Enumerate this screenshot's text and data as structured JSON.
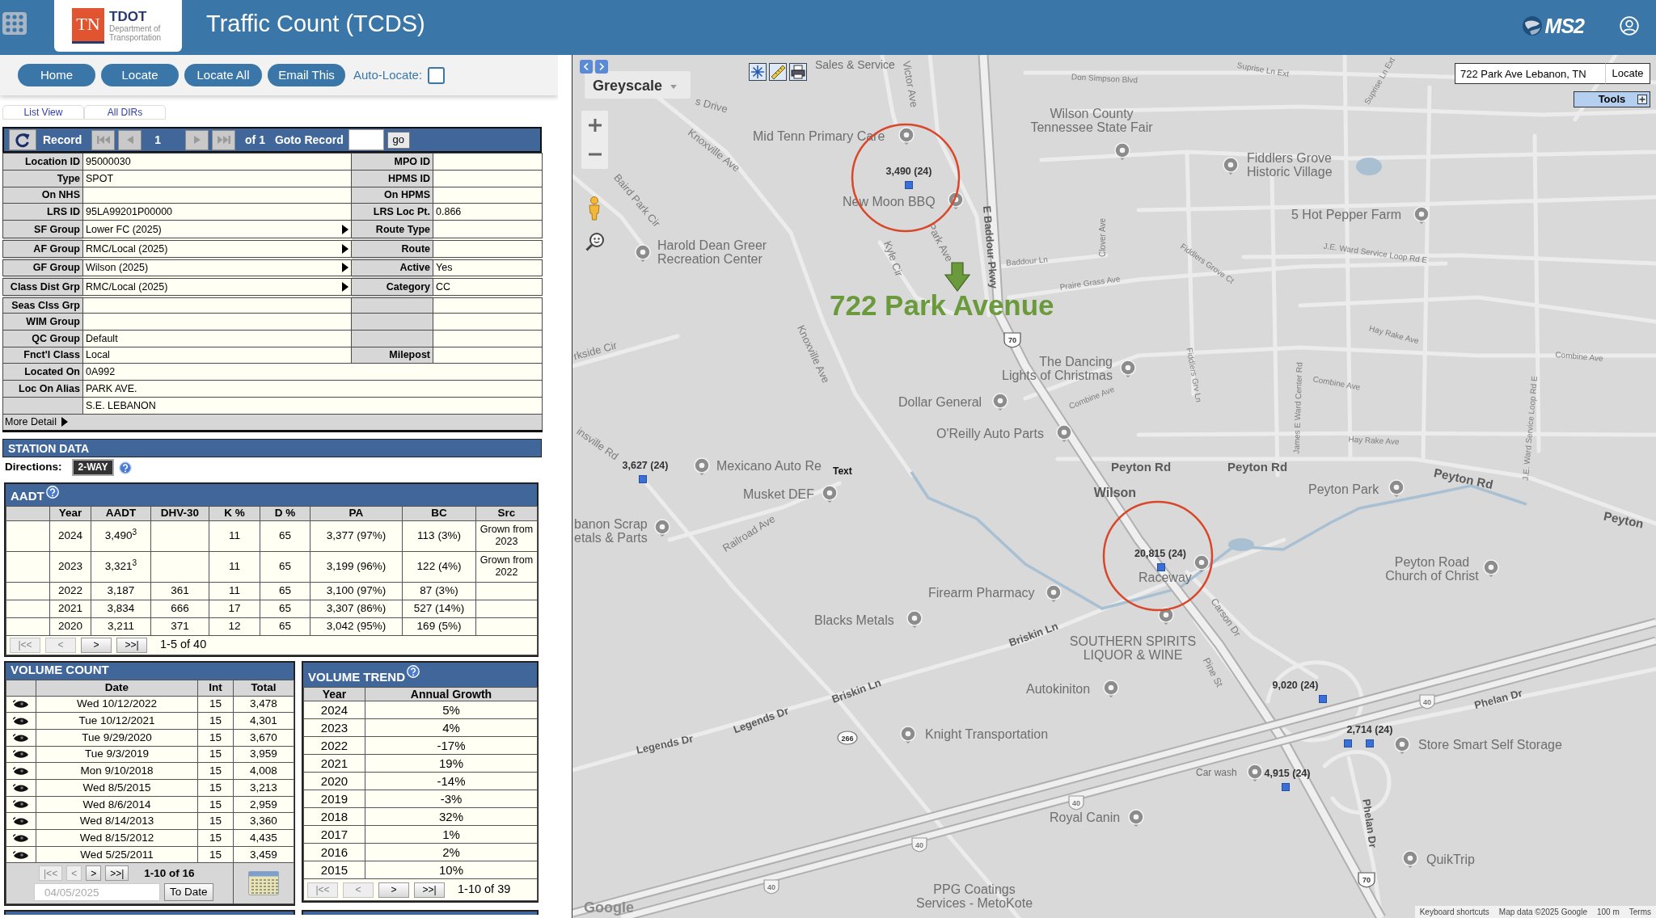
{
  "header": {
    "title": "Traffic Count (TCDS)",
    "logo": {
      "mark": "TN",
      "name": "TDOT",
      "subtitle": "Department of Transportation"
    },
    "brand": "MS2"
  },
  "toolbar": {
    "buttons": [
      "Home",
      "Locate",
      "Locate All",
      "Email This"
    ],
    "auto_locate": {
      "label": "Auto-Locate:",
      "checked": false
    }
  },
  "view_links": [
    "List View",
    "All DIRs"
  ],
  "record_bar": {
    "label": "Record",
    "current": "1",
    "total": "of 1",
    "goto_label": "Goto Record",
    "go_button": "go"
  },
  "location": {
    "rows": [
      {
        "kind": "pair",
        "label": "Location ID",
        "value": "95000030",
        "right_label": "MPO ID",
        "submenu": false
      },
      {
        "kind": "pair",
        "label": "Type",
        "value": "SPOT",
        "right_label": "HPMS ID",
        "submenu": false
      },
      {
        "kind": "pair",
        "label": "On NHS",
        "right_label": "On HPMS",
        "submenu": false
      },
      {
        "kind": "pair",
        "label": "LRS ID",
        "value": "95LA99201P00000",
        "right_label": "LRS Loc Pt.",
        "right_value": "0.866",
        "submenu": false
      },
      {
        "kind": "pair",
        "label": "SF Group",
        "value": "Lower FC (2025)",
        "right_label": "Route Type",
        "submenu": true
      },
      {
        "kind": "pair",
        "label": "AF Group",
        "value": "RMC/Local (2025)",
        "right_label": "Route",
        "submenu": true
      },
      {
        "kind": "pair",
        "label": "GF Group",
        "value": "Wilson (2025)",
        "right_label": "Active",
        "right_value": "Yes",
        "submenu": true
      },
      {
        "kind": "pair",
        "label": "Class Dist Grp",
        "value": "RMC/Local (2025)",
        "right_label": "Category",
        "right_value": "CC",
        "submenu": true
      },
      {
        "kind": "pair",
        "label": "Seas Clss Grp",
        "submenu": false
      },
      {
        "kind": "pair",
        "label": "WIM Group",
        "submenu": false
      },
      {
        "kind": "pair",
        "label": "QC Group",
        "value": "Default",
        "submenu": false
      },
      {
        "kind": "pair",
        "label": "Fnct'l Class",
        "value": "Local",
        "right_label": "Milepost",
        "submenu": false
      },
      {
        "kind": "wide",
        "label": "Located On",
        "value": "0A992",
        "submenu": false
      },
      {
        "kind": "wide",
        "label": "Loc On Alias",
        "value": "PARK AVE.",
        "submenu": false
      },
      {
        "kind": "wide",
        "value": "S.E. LEBANON",
        "submenu": false
      }
    ],
    "more_detail": "More Detail"
  },
  "station": {
    "title": "STATION DATA",
    "directions_label": "Directions:",
    "directions": "2-WAY"
  },
  "aadt": {
    "title": "AADT",
    "columns": [
      "Year",
      "AADT",
      "DHV-30",
      "K %",
      "D %",
      "PA",
      "BC",
      "Src"
    ],
    "rows": [
      {
        "year": "2024",
        "aadt": "3,490$^{3}$",
        "k": "11",
        "d": "65",
        "pa": "3,377 (97%)",
        "bc": "113 (3%)",
        "src": "Grown from 2023"
      },
      {
        "year": "2023",
        "aadt": "3,321$^{3}$",
        "k": "11",
        "d": "65",
        "pa": "3,199 (96%)",
        "bc": "122 (4%)",
        "src": "Grown from 2022"
      },
      {
        "year": "2022",
        "aadt": "3,187",
        "dhv": "361",
        "k": "11",
        "d": "65",
        "pa": "3,100 (97%)",
        "bc": "87 (3%)"
      },
      {
        "year": "2021",
        "aadt": "3,834",
        "dhv": "666",
        "k": "17",
        "d": "65",
        "pa": "3,307 (86%)",
        "bc": "527 (14%)"
      },
      {
        "year": "2020",
        "aadt": "3,211",
        "dhv": "371",
        "k": "12",
        "d": "65",
        "pa": "3,042 (95%)",
        "bc": "169 (5%)"
      }
    ],
    "pager": {
      "buttons": [
        {
          "label": "|<<",
          "disabled": true
        },
        {
          "label": "<",
          "disabled": true
        },
        {
          "label": ">",
          "disabled": false
        },
        {
          "label": ">>|",
          "disabled": false
        }
      ],
      "status": "1-5 of 40"
    }
  },
  "volume_count": {
    "title": "VOLUME COUNT",
    "columns": [
      "Date",
      "Int",
      "Total"
    ],
    "rows": [
      {
        "date": "Wed 10/12/2022",
        "int": "15",
        "total": "3,478"
      },
      {
        "date": "Tue 10/12/2021",
        "int": "15",
        "total": "4,301"
      },
      {
        "date": "Tue 9/29/2020",
        "int": "15",
        "total": "3,670"
      },
      {
        "date": "Tue 9/3/2019",
        "int": "15",
        "total": "3,959"
      },
      {
        "date": "Mon 9/10/2018",
        "int": "15",
        "total": "4,008"
      },
      {
        "date": "Wed 8/5/2015",
        "int": "15",
        "total": "3,213"
      },
      {
        "date": "Wed 8/6/2014",
        "int": "15",
        "total": "2,959"
      },
      {
        "date": "Wed 8/14/2013",
        "int": "15",
        "total": "3,360"
      },
      {
        "date": "Wed 8/15/2012",
        "int": "15",
        "total": "4,435"
      },
      {
        "date": "Wed 5/25/2011",
        "int": "15",
        "total": "3,459"
      }
    ],
    "pager": {
      "buttons": [
        {
          "label": "|<<",
          "disabled": true
        },
        {
          "label": "<",
          "disabled": true
        },
        {
          "label": ">",
          "disabled": false
        },
        {
          "label": ">>|",
          "disabled": false
        }
      ],
      "status": "1-10 of 16"
    },
    "date_field": {
      "placeholder": "04/05/2025"
    },
    "to_date_button": "To Date"
  },
  "volume_trend": {
    "title": "VOLUME TREND",
    "columns": [
      "Year",
      "Annual Growth"
    ],
    "rows": [
      {
        "year": "2024",
        "growth": "5%"
      },
      {
        "year": "2023",
        "growth": "4%"
      },
      {
        "year": "2022",
        "growth": "-17%"
      },
      {
        "year": "2021",
        "growth": "19%"
      },
      {
        "year": "2020",
        "growth": "-14%"
      },
      {
        "year": "2019",
        "growth": "-3%"
      },
      {
        "year": "2018",
        "growth": "32%"
      },
      {
        "year": "2017",
        "growth": "1%"
      },
      {
        "year": "2016",
        "growth": "2%"
      },
      {
        "year": "2015",
        "growth": "10%"
      }
    ],
    "pager": {
      "buttons": [
        {
          "label": "|<<",
          "disabled": true
        },
        {
          "label": "<",
          "disabled": true
        },
        {
          "label": ">",
          "disabled": false
        },
        {
          "label": ">>|",
          "disabled": false
        }
      ],
      "status": "1-10 of 39"
    }
  },
  "map": {
    "style_control": "Greyscale",
    "search": {
      "value": "722 Park Ave Lebanon, TN",
      "button": "Locate"
    },
    "tools": "Tools",
    "address_label": "722 Park Avenue",
    "places": [
      {
        "lines": [
          "Sales & Service"
        ]
      },
      {
        "lines": [
          "Mid Tenn Primary Care"
        ]
      },
      {
        "lines": [
          "New Moon BBQ"
        ]
      },
      {
        "lines": [
          "Wilson County",
          "Tennessee State Fair"
        ]
      },
      {
        "lines": [
          "Fiddlers Grove",
          "Historic Village"
        ]
      },
      {
        "lines": [
          "5 Hot Pepper Farm"
        ]
      },
      {
        "lines": [
          "Harold Dean Greer",
          "Recreation Center"
        ]
      },
      {
        "lines": [
          "The Dancing",
          "Lights of Christmas"
        ]
      },
      {
        "lines": [
          "Dollar General"
        ]
      },
      {
        "lines": [
          "O'Reilly Auto Parts"
        ]
      },
      {
        "lines": [
          "Mexicano Auto Re"
        ]
      },
      {
        "lines": [
          "Musket DEF"
        ]
      },
      {
        "lines": [
          "Peyton Park"
        ]
      },
      {
        "lines": [
          "banon Scrap",
          "etals & Parts"
        ]
      },
      {
        "lines": [
          "Raceway"
        ]
      },
      {
        "lines": [
          "Peyton Road",
          "Church of Christ"
        ]
      },
      {
        "lines": [
          "Firearm Pharmacy"
        ]
      },
      {
        "lines": [
          "Blacks Metals"
        ]
      },
      {
        "lines": [
          "SOUTHERN SPIRITS",
          "LIQUOR & WINE"
        ]
      },
      {
        "lines": [
          "Autokiniton"
        ]
      },
      {
        "lines": [
          "Knight Transportation"
        ]
      },
      {
        "lines": [
          "Store Smart Self Storage"
        ]
      },
      {
        "lines": [
          "Car wash"
        ]
      },
      {
        "lines": [
          "Royal Canin"
        ]
      },
      {
        "lines": [
          "QuikTrip"
        ]
      },
      {
        "lines": [
          "PPG Coatings",
          "Services - MetoKote"
        ]
      }
    ],
    "streets": [
      "s Drive",
      "Victor Ave",
      "Knoxville Ave",
      "Baird Park Cir",
      "Kyle Cir",
      "Park Ave",
      "E Baddour Pkwy",
      "Baddour Ln",
      "Don Simpson Blvd",
      "Suprise Ln Ext",
      "Suprise Ln Ext",
      "Clover Ave",
      "J.E. Ward Service Loop Rd E",
      "Fiddlers Grove Ct",
      "Praire Grass Ave",
      "Knoxville Ave",
      "rkside Cir",
      "Hay Rake Ave",
      "Combine Ave",
      "Combine Ave",
      "Combine Ave",
      "Fiddlers Grv Ln",
      "James E Ward Center Rd",
      "J.E. Ward Service Loop Rd E",
      "Hay Rake Ave",
      "insville Rd",
      "Railroad Ave",
      "Peyton Rd",
      "Peyton Rd",
      "Peyton Rd",
      "Peyton",
      "Carson Dr",
      "Briskin Ln",
      "Pine St",
      "Briskin Ln",
      "Phelan Dr",
      "Legends Dr",
      "Legends Dr",
      "Phelan Dr"
    ],
    "town": "Wilson",
    "annotation": "Text",
    "count_stations": [
      {
        "label": "3,490 (24)",
        "circled": true
      },
      {
        "label": "3,627 (24)",
        "circled": false
      },
      {
        "label": "20,815 (24)",
        "circled": true
      },
      {
        "label": "9,020 (24)",
        "circled": false
      },
      {
        "label": "2,714 (24)",
        "circled": false
      },
      {
        "label": "4,915 (24)",
        "circled": false
      }
    ],
    "route_shields": [
      "70",
      "40",
      "40",
      "40",
      "40",
      "266",
      "70"
    ],
    "logo": "Google",
    "attribution": [
      "Keyboard shortcuts",
      "Map data ©2025 Google",
      "100 m",
      "Terms"
    ]
  }
}
